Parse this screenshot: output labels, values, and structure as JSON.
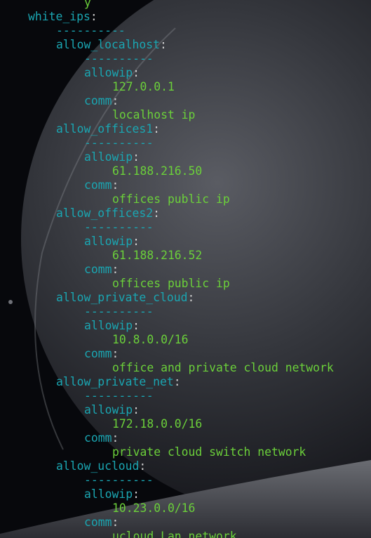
{
  "colors": {
    "key": "#1aa6b2",
    "value": "#6bd03a",
    "punctuation": "#d0d0d0",
    "background": "#07080c"
  },
  "yaml": {
    "top_partial": "y",
    "root_key": "white_ips",
    "separator": "----------",
    "entries": [
      {
        "key": "allow_localhost",
        "allowip_label": "allowip",
        "allowip": "127.0.0.1",
        "comm_label": "comm",
        "comm": "localhost ip"
      },
      {
        "key": "allow_offices1",
        "allowip_label": "allowip",
        "allowip": "61.188.216.50",
        "comm_label": "comm",
        "comm": "offices public ip"
      },
      {
        "key": "allow_offices2",
        "allowip_label": "allowip",
        "allowip": "61.188.216.52",
        "comm_label": "comm",
        "comm": "offices public ip"
      },
      {
        "key": "allow_private_cloud",
        "allowip_label": "allowip",
        "allowip": "10.8.0.0/16",
        "comm_label": "comm",
        "comm": "office and private cloud network"
      },
      {
        "key": "allow_private_net",
        "allowip_label": "allowip",
        "allowip": "172.18.0.0/16",
        "comm_label": "comm",
        "comm": "private cloud switch network"
      },
      {
        "key": "allow_ucloud",
        "allowip_label": "allowip",
        "allowip": "10.23.0.0/16",
        "comm_label": "comm",
        "comm": "ucloud Lan network"
      }
    ]
  }
}
